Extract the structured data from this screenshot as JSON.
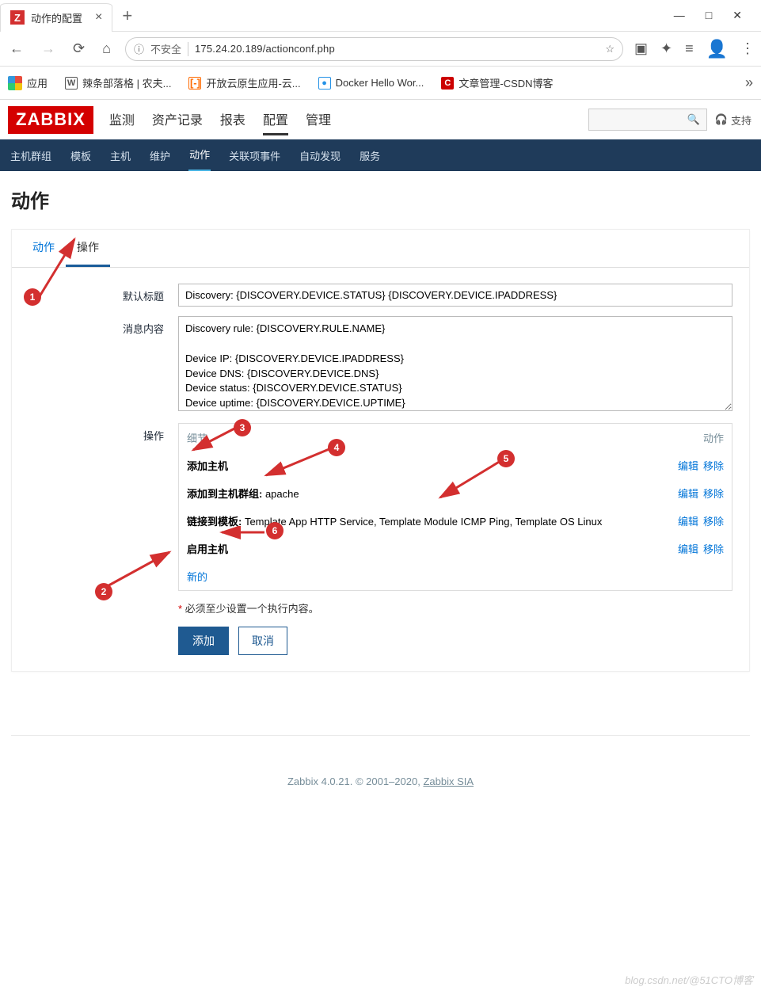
{
  "browser": {
    "tab_title": "动作的配置",
    "url_warning": "不安全",
    "url": "175.24.20.189/actionconf.php",
    "apps_label": "应用",
    "bookmarks": [
      {
        "label": "辣条部落格 | 农夫..."
      },
      {
        "label": "开放云原生应用-云..."
      },
      {
        "label": "Docker Hello Wor..."
      },
      {
        "label": "文章管理-CSDN博客"
      }
    ]
  },
  "zabbix": {
    "logo": "ZABBIX",
    "main_nav": [
      "监测",
      "资产记录",
      "报表",
      "配置",
      "管理"
    ],
    "main_nav_active": "配置",
    "support": "支持",
    "sub_nav": [
      "主机群组",
      "模板",
      "主机",
      "维护",
      "动作",
      "关联项事件",
      "自动发现",
      "服务"
    ],
    "sub_nav_active": "动作",
    "page_title": "动作",
    "tabs": [
      "动作",
      "操作"
    ],
    "tab_active": "操作",
    "form": {
      "label_subject": "默认标题",
      "subject_value": "Discovery: {DISCOVERY.DEVICE.STATUS} {DISCOVERY.DEVICE.IPADDRESS}",
      "label_message": "消息内容",
      "message_value": "Discovery rule: {DISCOVERY.RULE.NAME}\n\nDevice IP: {DISCOVERY.DEVICE.IPADDRESS}\nDevice DNS: {DISCOVERY.DEVICE.DNS}\nDevice status: {DISCOVERY.DEVICE.STATUS}\nDevice uptime: {DISCOVERY.DEVICE.UPTIME}",
      "label_ops": "操作",
      "ops_header_detail": "细节",
      "ops_header_action": "动作",
      "ops": [
        {
          "bold": "添加主机",
          "rest": ""
        },
        {
          "bold": "添加到主机群组:",
          "rest": " apache"
        },
        {
          "bold": "链接到模板:",
          "rest": " Template App HTTP Service, Template Module ICMP Ping, Template OS Linux"
        },
        {
          "bold": "启用主机",
          "rest": ""
        }
      ],
      "edit_label": "编辑",
      "remove_label": "移除",
      "new_label": "新的",
      "required_note": "必须至少设置一个执行内容。",
      "btn_add": "添加",
      "btn_cancel": "取消"
    },
    "footer": {
      "text": "Zabbix 4.0.21. © 2001–2020, ",
      "link": "Zabbix SIA"
    }
  },
  "watermark": "blog.csdn.net/@51CTO博客",
  "callouts": [
    "1",
    "2",
    "3",
    "4",
    "5",
    "6"
  ]
}
